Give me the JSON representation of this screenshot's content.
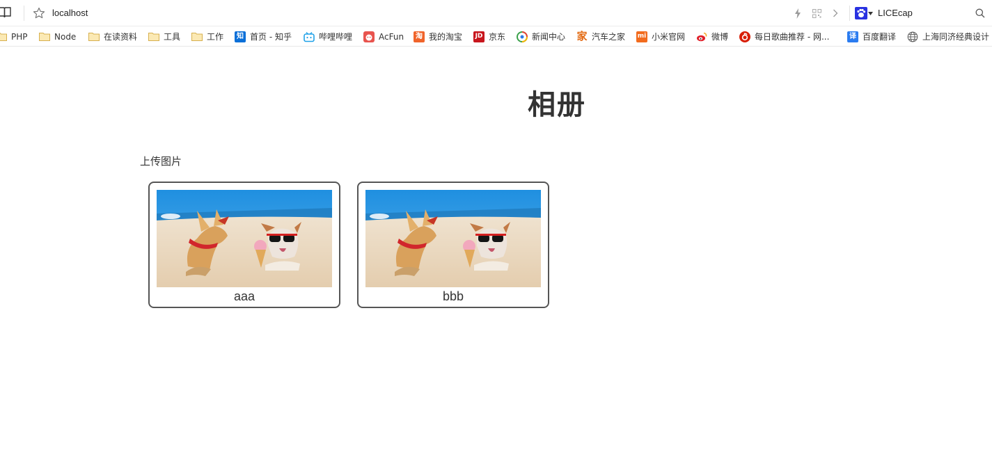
{
  "browser": {
    "address_url": "localhost",
    "search_engine_label": "LICEcap",
    "icons": [
      "book-icon",
      "star-icon",
      "bolt-icon",
      "qr-code-icon",
      "chevron-right-icon",
      "baidu-paw-icon",
      "search-icon"
    ]
  },
  "bookmarks": [
    {
      "label": "PHP",
      "icon": "folder-icon"
    },
    {
      "label": "Node",
      "icon": "folder-icon"
    },
    {
      "label": "在读资料",
      "icon": "folder-icon"
    },
    {
      "label": "工具",
      "icon": "folder-icon"
    },
    {
      "label": "工作",
      "icon": "folder-icon"
    },
    {
      "label": "首页 - 知乎",
      "icon": "zhihu-icon",
      "icon_text": "知",
      "color": "#0a6fd8"
    },
    {
      "label": "哔哩哔哩",
      "icon": "bilibili-icon",
      "color": "#1ea1e8"
    },
    {
      "label": "AcFun",
      "icon": "acfun-icon",
      "color": "#e8544e"
    },
    {
      "label": "我的淘宝",
      "icon": "taobao-icon",
      "icon_text": "淘",
      "color": "#f0642b"
    },
    {
      "label": "京东",
      "icon": "jd-icon",
      "icon_text": "JD",
      "color": "#c8161d"
    },
    {
      "label": "新闻中心",
      "icon": "news-center-icon"
    },
    {
      "label": "汽车之家",
      "icon": "autohome-icon",
      "icon_text": "家",
      "color": "#e36a12"
    },
    {
      "label": "小米官网",
      "icon": "xiaomi-icon",
      "icon_text": "mi",
      "color": "#f26b1d"
    },
    {
      "label": "微博",
      "icon": "weibo-icon",
      "color": "#e0202a"
    },
    {
      "label": "每日歌曲推荐 - 网...",
      "icon": "netease-music-icon",
      "color": "#d81e06"
    },
    {
      "label": "百度翻译",
      "icon": "baidu-translate-icon",
      "icon_text": "译",
      "color": "#2b7cf0"
    },
    {
      "label": "上海同济经典设计",
      "icon": "globe-icon"
    }
  ],
  "page": {
    "title": "相册",
    "upload_label": "上传图片"
  },
  "album": {
    "photos": [
      {
        "caption": "aaa",
        "image": "dogs-on-beach-photo"
      },
      {
        "caption": "bbb",
        "image": "dogs-on-beach-photo"
      }
    ]
  },
  "colors": {
    "card_border": "#555555",
    "text": "#333333"
  }
}
